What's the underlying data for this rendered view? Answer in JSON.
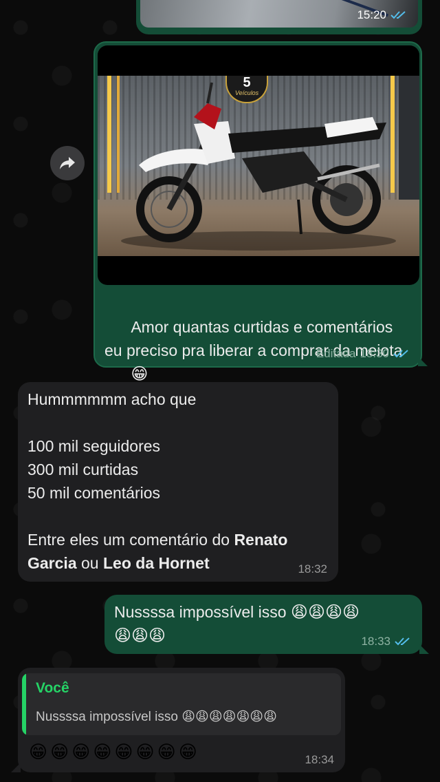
{
  "messages": {
    "prev": {
      "time": "15:20"
    },
    "photo_msg": {
      "caption": "Amor quantas curtidas e comentários eu preciso pra liberar a comprar da meiota",
      "emoji": "😁",
      "edited_label": "Editada",
      "time": "18:30",
      "sign_text": "Veículos",
      "sign_digit": "5"
    },
    "reply1": {
      "line1": "Hummmmmm acho que",
      "line2": "100 mil seguidores",
      "line3": "300 mil curtidas",
      "line4": "50 mil comentários",
      "line5_pre": "Entre eles um comentário do ",
      "line5_bold": "Renato",
      "line6_bold": "Garcia",
      "line6_mid": " ou ",
      "line6_bold2": "Leo da Hornet",
      "time": "18:32"
    },
    "out2": {
      "text": "Nussssa impossível isso",
      "emojis1": "😩😩😩😩",
      "emojis2": "😩😩😩",
      "time": "18:33"
    },
    "reply2": {
      "quote_author": "Você",
      "quote_text": "Nussssa impossível isso",
      "quote_emojis": "😩😩😩😩😩😩😩",
      "text_emojis": "😁😁😁😁😁😁😁😁",
      "time": "18:34"
    }
  },
  "colors": {
    "outgoing": "#144d37",
    "incoming": "#1f1f21",
    "quote_accent": "#25d366",
    "read_ticks": "#53bdeb"
  },
  "icons": [
    "forward-icon",
    "double-check-icon"
  ]
}
